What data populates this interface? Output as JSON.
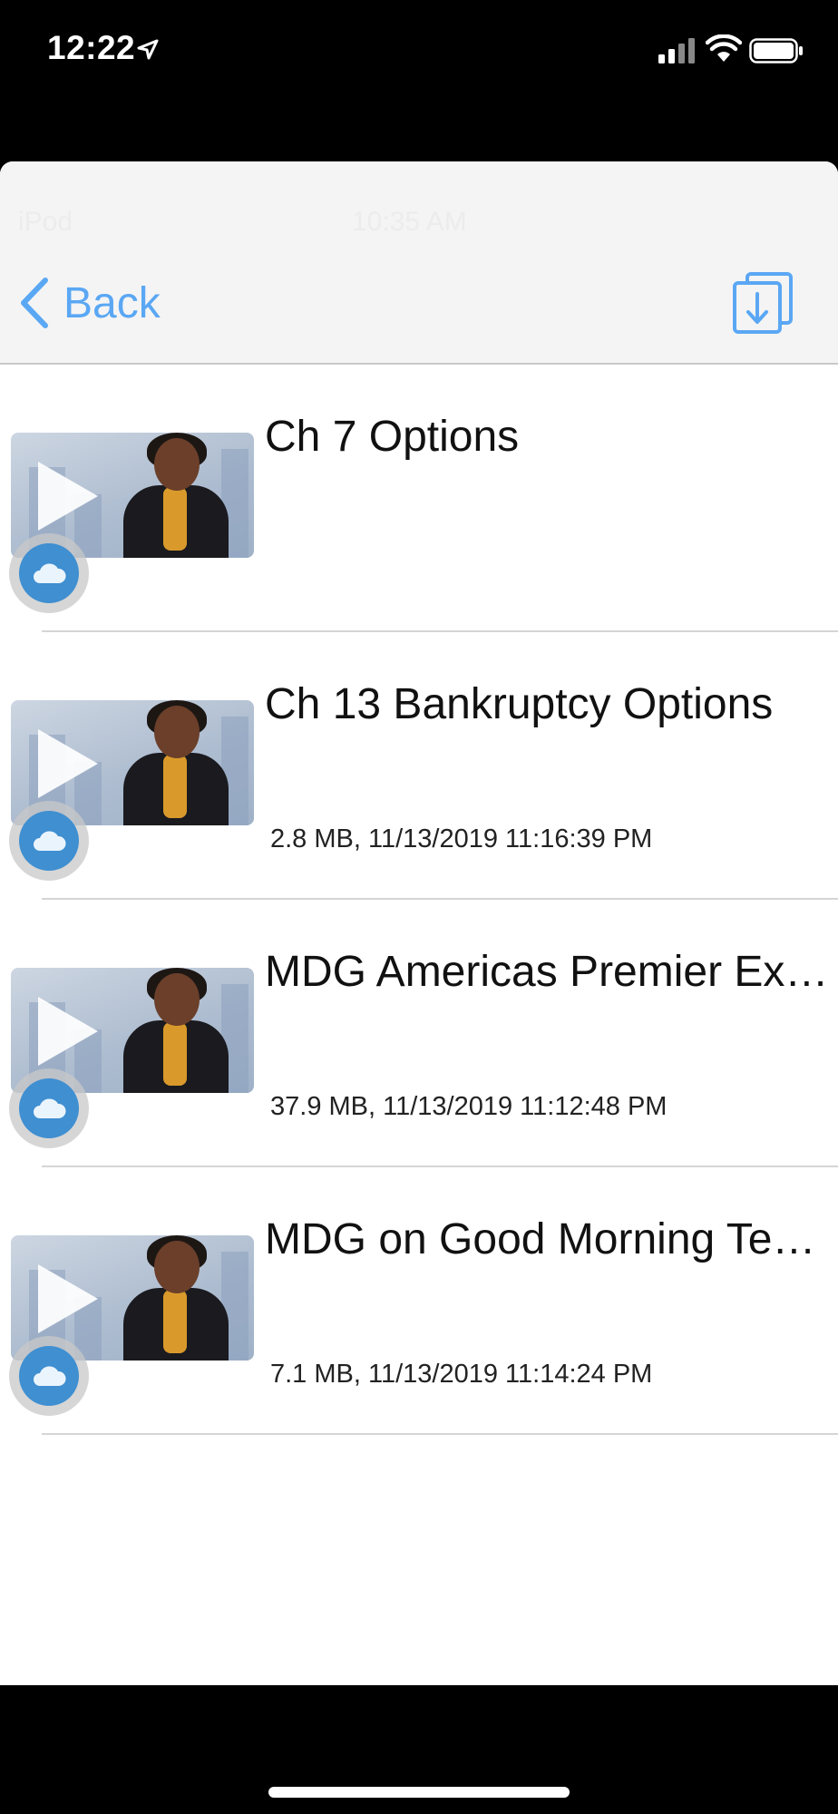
{
  "status_bar": {
    "time": "12:22",
    "icons": [
      "location-arrow-icon",
      "signal-bars-icon",
      "wifi-icon",
      "battery-icon"
    ]
  },
  "nav": {
    "back_label": "Back",
    "ghost": {
      "carrier": "iPod",
      "time": "10:35 AM"
    },
    "accent_color": "#5aa7f4"
  },
  "videos": [
    {
      "title": "Ch 7 Options",
      "meta": ""
    },
    {
      "title": "Ch 13 Bankruptcy Options",
      "meta": "2.8 MB, 11/13/2019 11:16:39 PM"
    },
    {
      "title": "MDG Americas Premier Expert",
      "meta": "37.9 MB, 11/13/2019 11:12:48 PM"
    },
    {
      "title": "MDG on Good Morning Texas",
      "meta": "7.1 MB, 11/13/2019 11:14:24 PM"
    }
  ]
}
